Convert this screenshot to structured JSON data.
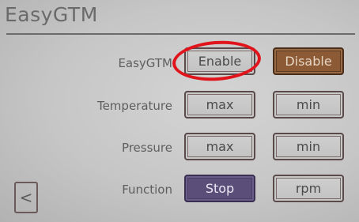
{
  "screen": {
    "title": "EasyGTM"
  },
  "rows": [
    {
      "label": "EasyGTM",
      "left": "Enable",
      "right": "Disable"
    },
    {
      "label": "Temperature",
      "left": "max",
      "right": "min"
    },
    {
      "label": "Pressure",
      "left": "max",
      "right": "min"
    },
    {
      "label": "Function",
      "left": "Stop",
      "right": "rpm"
    }
  ],
  "nav": {
    "back": "<"
  },
  "colors": {
    "selected_disable": "#8c5a34",
    "selected_stop": "#5b4f79",
    "annotation_circle": "#e0141a"
  }
}
